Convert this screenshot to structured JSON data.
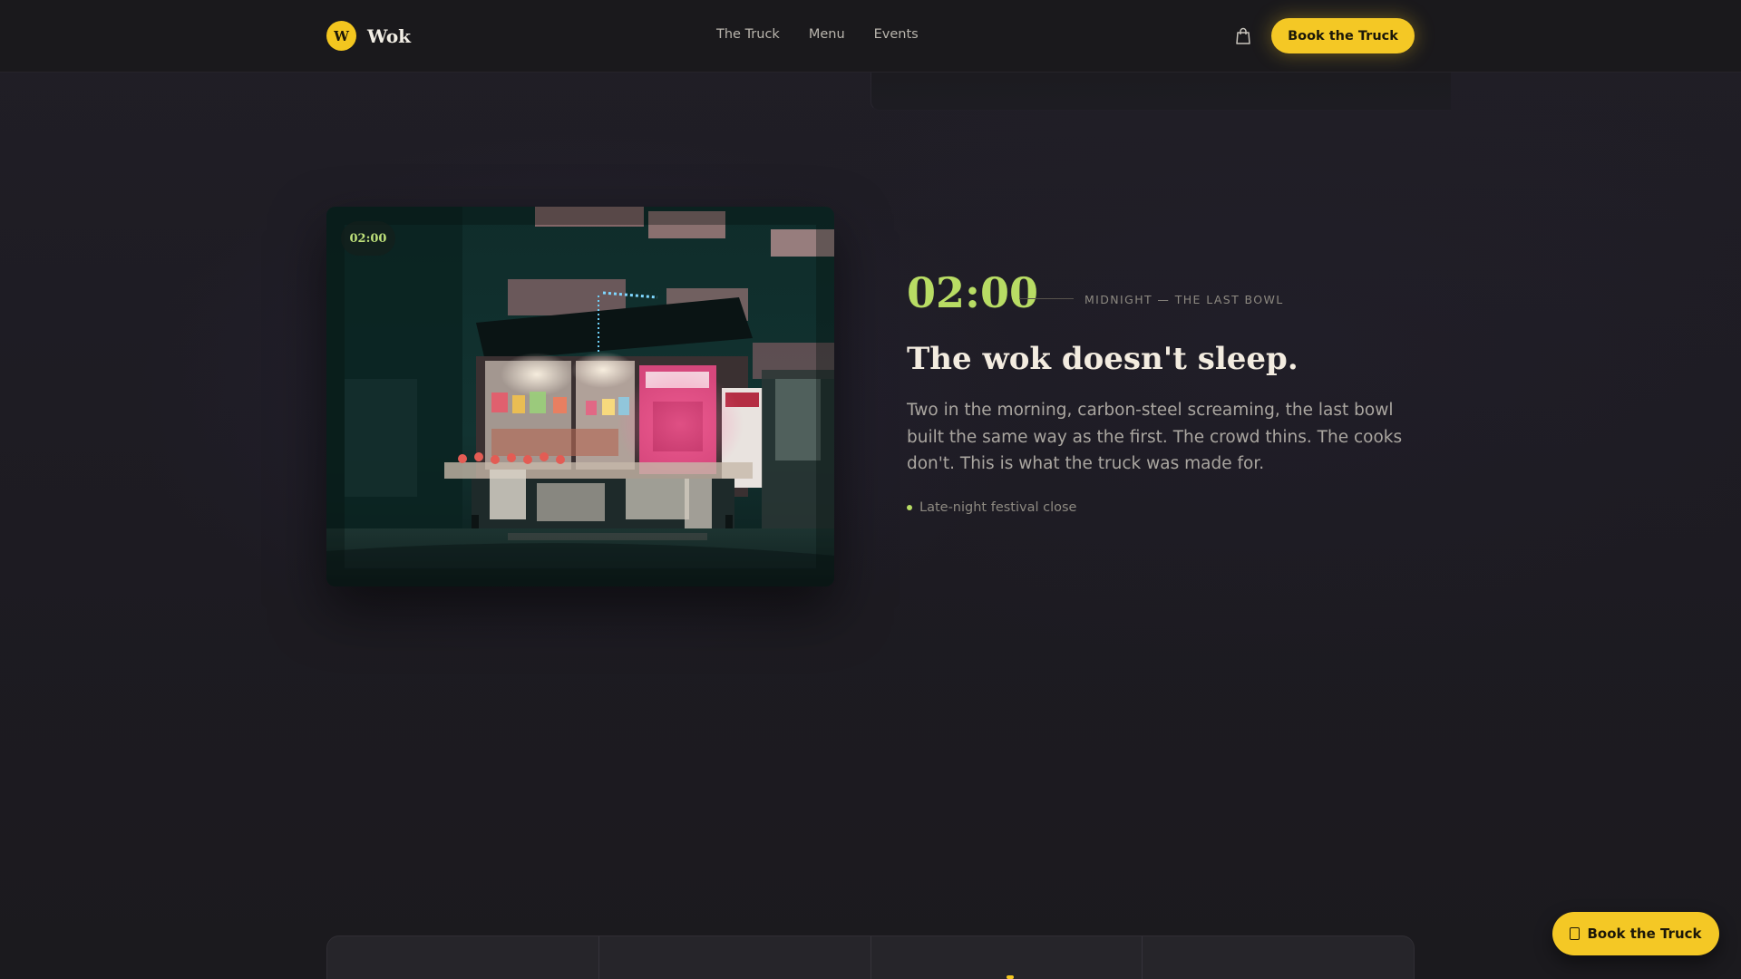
{
  "header": {
    "brand_letter": "W",
    "brand_name": "Wok",
    "nav": [
      {
        "label": "The Truck"
      },
      {
        "label": "Menu"
      },
      {
        "label": "Events"
      }
    ],
    "cart_icon": "shopping-bag-icon",
    "cta_label": "Book the Truck"
  },
  "hero": {
    "photo_badge": "02:00",
    "time": "02:00",
    "time_caption": "MIDNIGHT — THE LAST BOWL",
    "headline": "The wok doesn't sleep.",
    "body": "Two in the morning, carbon-steel screaming, the last bowl built the same way as the first. The crowd thins. The cooks don't. This is what the truck was made for.",
    "tag": "Late-night festival close"
  },
  "floating_cta": {
    "icon": "calendar-icon",
    "label": "Book the Truck"
  },
  "colors": {
    "accent_yellow": "#f4c825",
    "accent_green": "#b8dc64",
    "background": "#1c1a1f"
  }
}
